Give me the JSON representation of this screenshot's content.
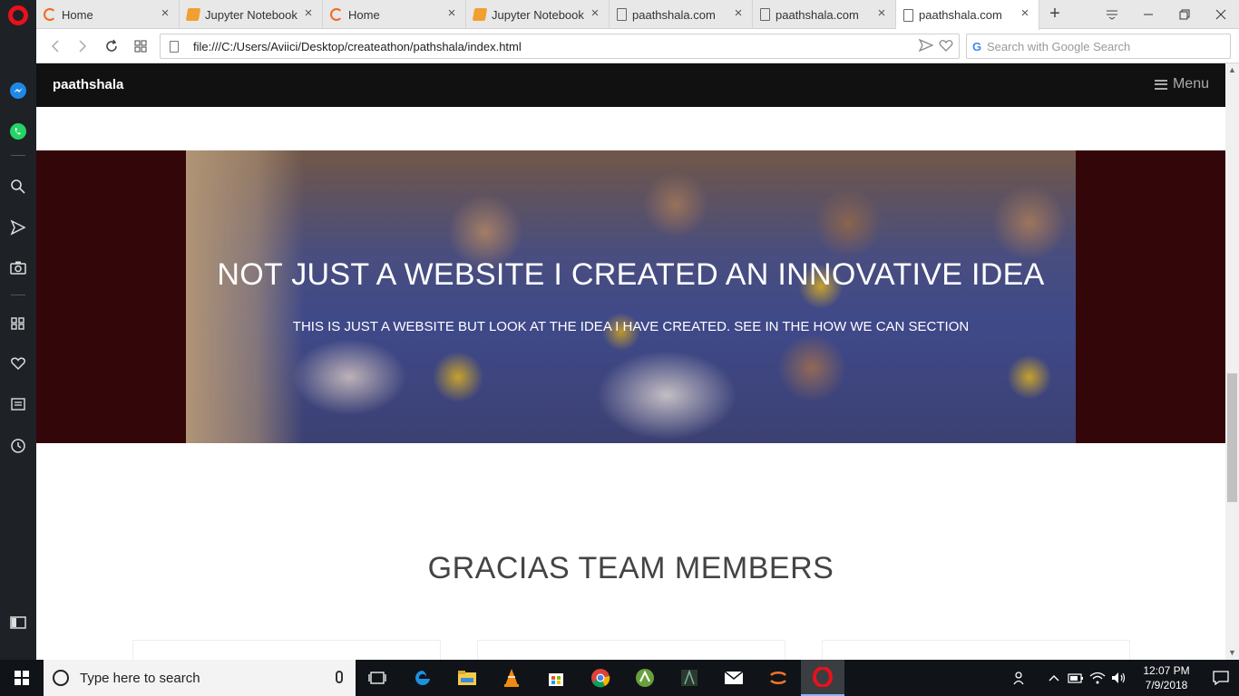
{
  "browser": {
    "tabs": [
      {
        "label": "Home",
        "icon": "opera-icon"
      },
      {
        "label": "Jupyter Notebook",
        "icon": "jupyter-icon"
      },
      {
        "label": "Home",
        "icon": "opera-icon"
      },
      {
        "label": "Jupyter Notebook",
        "icon": "jupyter-icon"
      },
      {
        "label": "paathshala.com",
        "icon": "page-icon"
      },
      {
        "label": "paathshala.com",
        "icon": "page-icon"
      },
      {
        "label": "paathshala.com",
        "icon": "page-icon",
        "active": true
      }
    ],
    "url": "file:///C:/Users/Aviici/Desktop/createathon/pathshala/index.html",
    "search_placeholder": "Search with Google Search",
    "accent": "#e8111a"
  },
  "site": {
    "brand": "paathshala",
    "menu_label": "Menu",
    "hero": {
      "title": "NOT JUST A WEBSITE I CREATED AN INNOVATIVE IDEA",
      "subtitle": "THIS IS JUST A WEBSITE BUT LOOK AT THE IDEA I HAVE CREATED. SEE IN THE HOW WE CAN SECTION",
      "background": "#330709"
    },
    "team_heading": "GRACIAS TEAM MEMBERS"
  },
  "taskbar": {
    "search_placeholder": "Type here to search",
    "time": "12:07 PM",
    "date": "7/9/2018"
  }
}
